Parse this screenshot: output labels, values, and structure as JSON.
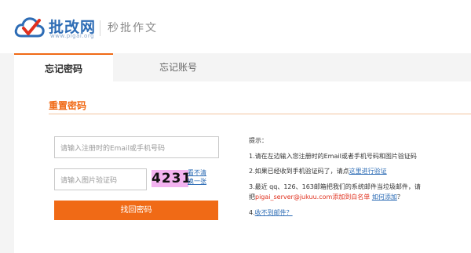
{
  "header": {
    "brand": "批改网",
    "domain": "www.pigai.org",
    "slogan": "秒批作文"
  },
  "tabs": [
    {
      "label": "忘记密码",
      "active": true
    },
    {
      "label": "忘记账号",
      "active": false
    }
  ],
  "section": {
    "title": "重置密码"
  },
  "form": {
    "phone_placeholder": "请输入注册时的Email或手机号码",
    "captcha_placeholder": "请输入图片验证码",
    "captcha_code": "4231",
    "refresh_line1": "看不清",
    "refresh_line2": "换一张",
    "submit_label": "找回密码"
  },
  "tips": {
    "heading": "提示：",
    "tip1": "1.请在左边输入您注册时的Email或者手机号码和图片验证码",
    "tip2_text": "2.如果已经收到手机验证码了，请点",
    "tip2_link": "这里进行验证",
    "tip3_line1": "3.最近 qq、126、163邮箱把我们的系统邮件当垃圾邮件，请",
    "tip3_prefix": "把",
    "tip3_email": "pigai_server@jukuu.com",
    "tip3_whitelist": "添加到白名单",
    "tip3_howto": "如何添加",
    "tip3_q": "？",
    "tip4_prefix": "4.",
    "tip4_link": "收不到邮件？"
  },
  "colors": {
    "accent": "#f06a16",
    "brand_blue": "#2d6cb5",
    "captcha_bg": "#f3b3f0"
  }
}
